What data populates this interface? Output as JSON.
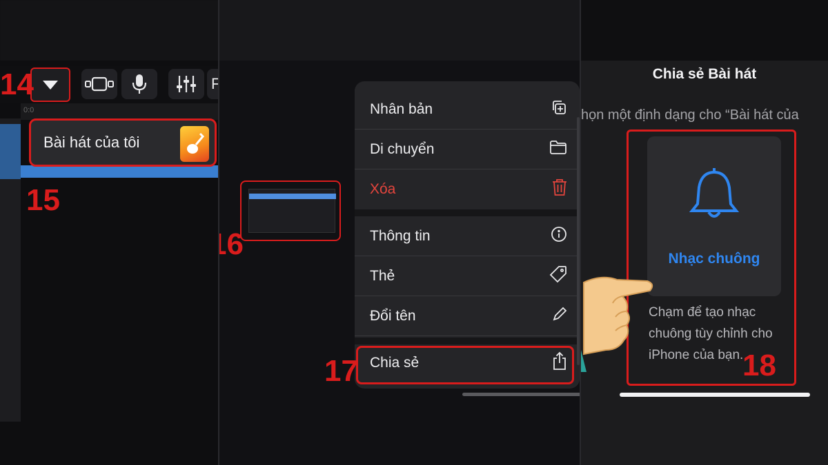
{
  "steps": {
    "s14": "14",
    "s15": "15",
    "s16": "16",
    "s17": "17",
    "s18": "18"
  },
  "panel1": {
    "toolbar_partial_label": "F",
    "timeline_marker": "0:0",
    "song_tag_label": "Bài hát của tôi",
    "app_icon": "garageband-icon"
  },
  "panel2": {
    "menu": [
      {
        "label": "Nhân bản",
        "icon": "duplicate-icon"
      },
      {
        "label": "Di chuyển",
        "icon": "folder-icon"
      },
      {
        "label": "Xóa",
        "icon": "trash-icon",
        "color": "#e5453d"
      },
      {
        "label": "Thông tin",
        "icon": "info-icon"
      },
      {
        "label": "Thẻ",
        "icon": "tag-icon"
      },
      {
        "label": "Đổi tên",
        "icon": "pencil-icon"
      },
      {
        "label": "Chia sẻ",
        "icon": "share-icon"
      }
    ]
  },
  "panel3": {
    "title": "Chia sẻ Bài hát",
    "subtitle": "họn một định dạng cho “Bài hát của",
    "ringtone_label": "Nhạc chuông",
    "ringtone_desc": "Chạm để tạo nhạc chuông tùy chỉnh cho iPhone của bạn.",
    "accent": "#2f86f0"
  },
  "highlight_color": "#d91c1c"
}
